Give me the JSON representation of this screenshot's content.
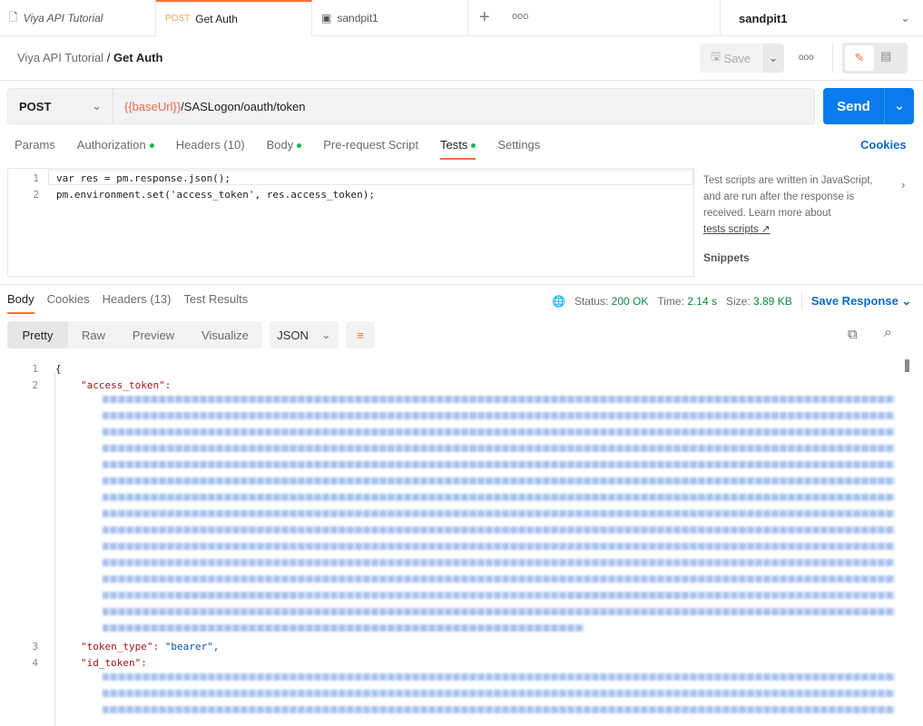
{
  "tabs": [
    {
      "label": "Viya API Tutorial"
    },
    {
      "method": "POST",
      "label": "Get Auth"
    },
    {
      "label": "sandpit1"
    }
  ],
  "environment": "sandpit1",
  "breadcrumb": {
    "parent": "Viya API Tutorial",
    "sep": "/",
    "current": "Get Auth"
  },
  "toolbar": {
    "save": "Save"
  },
  "request": {
    "method": "POST",
    "url_var": "{{baseUrl}}",
    "url_path": "/SASLogon/oauth/token",
    "send": "Send"
  },
  "req_tabs": [
    "Params",
    "Authorization",
    "Headers (10)",
    "Body",
    "Pre-request Script",
    "Tests",
    "Settings"
  ],
  "cookies": "Cookies",
  "script": {
    "lines": [
      "var res = pm.response.json();",
      "pm.environment.set('access_token', res.access_token);"
    ]
  },
  "side": {
    "text": "Test scripts are written in JavaScript, and are run after the response is received. Learn more about",
    "link": "tests scripts ↗",
    "snippets": "Snippets"
  },
  "resp_tabs": [
    "Body",
    "Cookies",
    "Headers (13)",
    "Test Results"
  ],
  "status": {
    "status_label": "Status:",
    "status": "200 OK",
    "time_label": "Time:",
    "time": "2.14 s",
    "size_label": "Size:",
    "size": "3.89 KB",
    "save_response": "Save Response"
  },
  "views": [
    "Pretty",
    "Raw",
    "Preview",
    "Visualize"
  ],
  "format": "JSON",
  "json": {
    "l1": "{",
    "k_access": "\"access_token\":",
    "k_type": "\"token_type\":",
    "v_type": " \"bearer\",",
    "k_id": "\"id_token\":"
  },
  "line_numbers": [
    "1",
    "2",
    "3",
    "4"
  ]
}
